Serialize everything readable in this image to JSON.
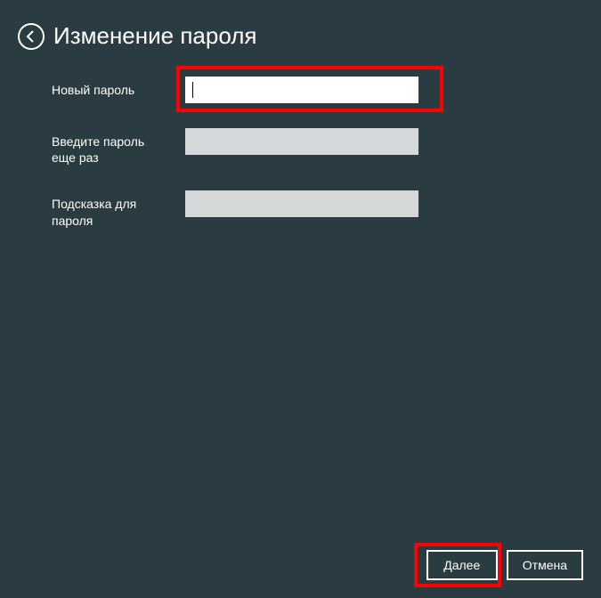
{
  "header": {
    "title": "Изменение пароля"
  },
  "form": {
    "new_password": {
      "label": "Новый пароль",
      "value": ""
    },
    "confirm_password": {
      "label": "Введите пароль еще раз",
      "value": ""
    },
    "password_hint": {
      "label": "Подсказка для пароля",
      "value": ""
    }
  },
  "footer": {
    "next_label": "Далее",
    "cancel_label": "Отмена"
  }
}
